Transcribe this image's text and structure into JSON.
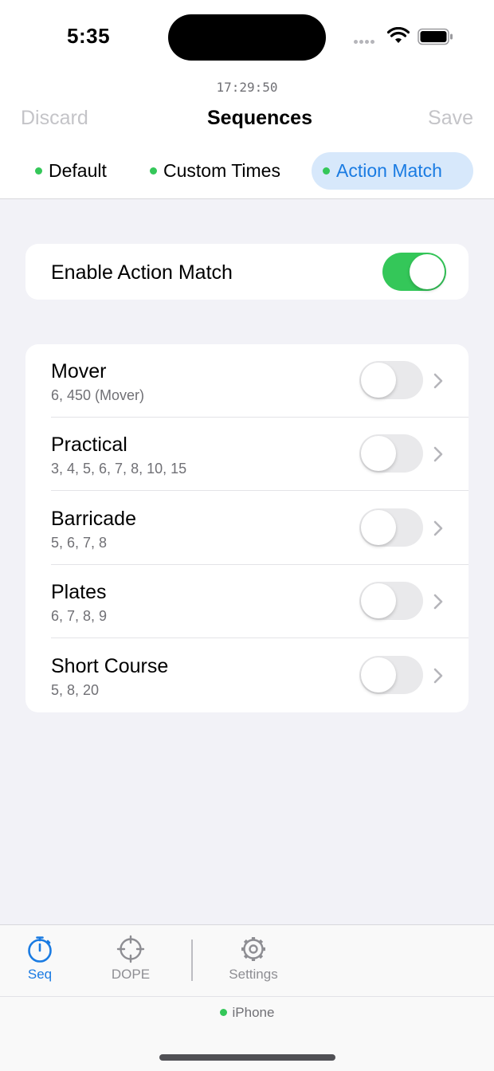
{
  "status_bar": {
    "time": "5:35"
  },
  "clock": "17:29:50",
  "nav": {
    "left": "Discard",
    "title": "Sequences",
    "right": "Save"
  },
  "segments": [
    {
      "label": "Default",
      "selected": false
    },
    {
      "label": "Custom Times",
      "selected": false
    },
    {
      "label": "Action Match",
      "selected": true
    }
  ],
  "enable": {
    "label": "Enable Action Match",
    "on": true
  },
  "sequences": [
    {
      "title": "Mover",
      "subtitle": "6, 450 (Mover)",
      "on": false
    },
    {
      "title": "Practical",
      "subtitle": "3, 4, 5, 6, 7, 8, 10, 15",
      "on": false
    },
    {
      "title": "Barricade",
      "subtitle": "5, 6, 7, 8",
      "on": false
    },
    {
      "title": "Plates",
      "subtitle": "6, 7, 8, 9",
      "on": false
    },
    {
      "title": "Short Course",
      "subtitle": "5, 8, 20",
      "on": false
    }
  ],
  "tabs": [
    {
      "label": "Seq",
      "icon": "stopwatch-icon",
      "active": true
    },
    {
      "label": "DOPE",
      "icon": "crosshair-icon",
      "active": false
    },
    {
      "label": "Settings",
      "icon": "gear-icon",
      "active": false
    }
  ],
  "device": {
    "label": "iPhone"
  },
  "colors": {
    "accent": "#1a7be2",
    "green": "#34c759",
    "background": "#f2f2f7"
  }
}
